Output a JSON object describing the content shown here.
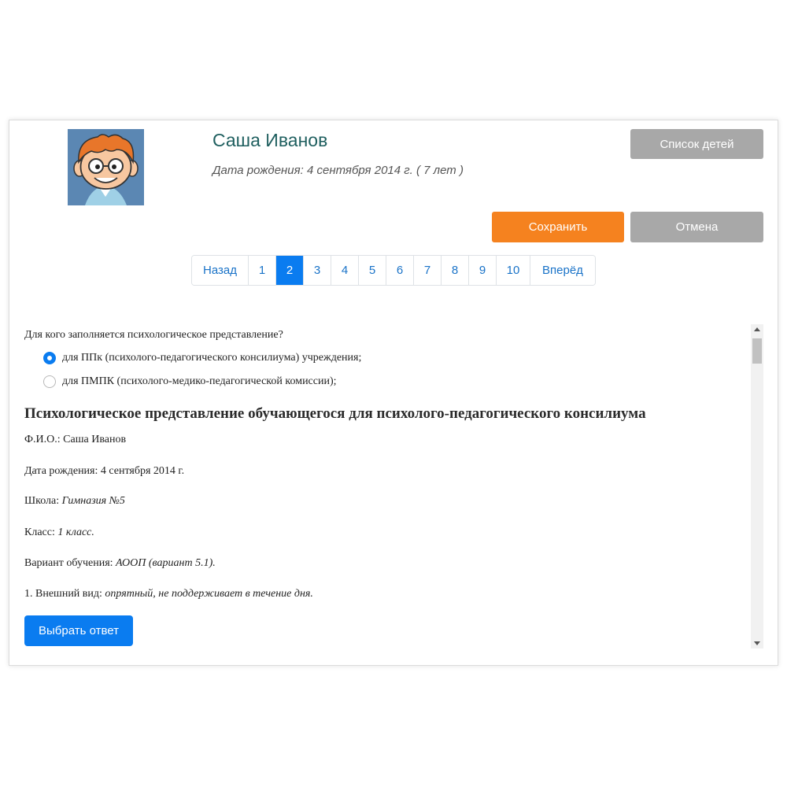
{
  "colors": {
    "accent_blue": "#0a7cf0",
    "save_orange": "#f5821f",
    "gray_button": "#a8a8a8",
    "name_teal": "#1f5f5f"
  },
  "profile": {
    "avatar_icon": "cartoon-boy-avatar",
    "name": "Саша Иванов",
    "dob": "Дата рождения: 4 сентября 2014 г. ( 7 лет )"
  },
  "actions": {
    "children_list": "Список детей",
    "save": "Сохранить",
    "cancel": "Отмена"
  },
  "pagination": {
    "prev": "Назад",
    "pages": [
      "1",
      "2",
      "3",
      "4",
      "5",
      "6",
      "7",
      "8",
      "9",
      "10"
    ],
    "active_page": "2",
    "next": "Вперёд"
  },
  "form": {
    "question": "Для кого заполняется психологическое представление?",
    "options": [
      {
        "label": "для ППк (психолого-педагогического консилиума) учреждения;",
        "checked": true
      },
      {
        "label": "для ПМПК (психолого-медико-педагогической комиссии);",
        "checked": false
      }
    ],
    "doc_title": "Психологическое представление обучающегося для психолого-педагогического консилиума",
    "fields": {
      "fio_label": "Ф.И.О.:",
      "fio_value": "Саша Иванов",
      "dob_label": "Дата рождения:",
      "dob_value": "4 сентября 2014 г.",
      "school_label": "Школа:",
      "school_value": "Гимназия №5",
      "class_label": "Класс:",
      "class_value": "1 класс.",
      "variant_label": "Вариант обучения:",
      "variant_value": "АООП (вариант 5.1).",
      "appearance_label": "1. Внешний вид:",
      "appearance_value": "опрятный, не поддерживает в течение дня."
    },
    "choose_button": "Выбрать ответ"
  }
}
